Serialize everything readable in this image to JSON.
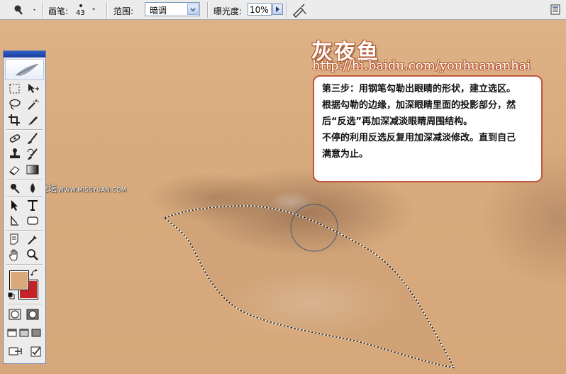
{
  "options_bar": {
    "brush_label": "画笔:",
    "brush_size": "43",
    "range_label": "范围:",
    "range_value": "暗调",
    "exposure_label": "曝光度:",
    "exposure_value": "10%",
    "tool_icon": "burn-tool-icon",
    "airbrush_icon": "airbrush-icon",
    "palette_icon": "palette-well-icon"
  },
  "canvas": {
    "watermark_title": "灰夜鱼",
    "watermark_url": "http://hi.baidu.com/youhuananhai",
    "site_watermark": "思缘设计论坛",
    "site_watermark_url": "WWW.MISSYUAN.COM",
    "note_lines": [
      "第三步：用钢笔勾勒出眼睛的形状，建立选区。",
      "根据勾勒的边缘，加深眼睛里面的投影部分，然",
      "后“反选”再加深减淡眼睛周围结构。",
      "不停的利用反选反复用加深减淡修改。直到自己",
      "满意为止。"
    ]
  },
  "toolbox": {
    "foreground_color": "#d9a97b",
    "background_color": "#c62228",
    "tools": [
      "marquee-tool-icon",
      "move-tool-icon",
      "lasso-tool-icon",
      "magic-wand-tool-icon",
      "crop-tool-icon",
      "slice-tool-icon",
      "healing-brush-tool-icon",
      "brush-tool-icon",
      "clone-stamp-tool-icon",
      "history-brush-tool-icon",
      "eraser-tool-icon",
      "gradient-tool-icon",
      "path-selection-tool-icon",
      "type-tool-icon",
      "pen-tool-icon",
      "shape-tool-icon",
      "notes-tool-icon",
      "eyedropper-tool-icon",
      "hand-tool-icon",
      "zoom-tool-icon"
    ]
  }
}
